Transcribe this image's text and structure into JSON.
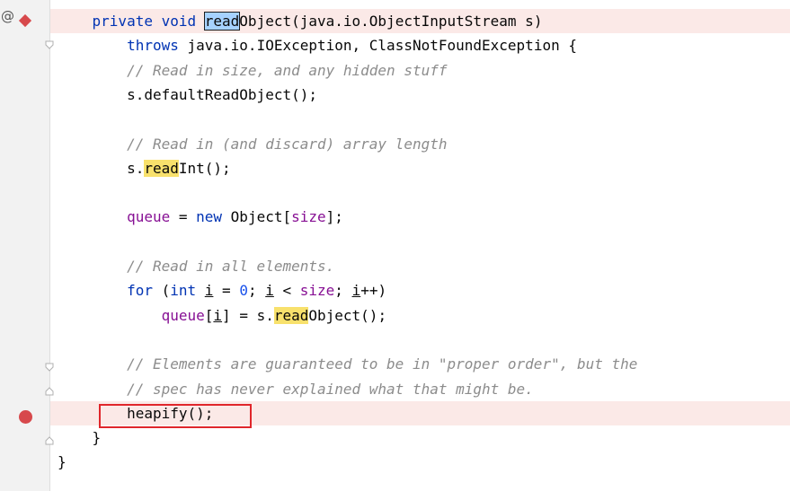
{
  "editor": {
    "lines": [
      {
        "parts": [
          {
            "t": "    "
          },
          {
            "t": "private void ",
            "c": "kw"
          },
          {
            "t": "read",
            "c": "sel"
          },
          {
            "t": "Object"
          },
          {
            "t": "(java.io.ObjectInputStream s)"
          }
        ],
        "hl": true
      },
      {
        "parts": [
          {
            "t": "        "
          },
          {
            "t": "throws ",
            "c": "kw"
          },
          {
            "t": "java.io.IOException, ClassNotFoundException {"
          }
        ]
      },
      {
        "parts": [
          {
            "t": "        "
          },
          {
            "t": "// Read in size, and any hidden stuff",
            "c": "cm"
          }
        ]
      },
      {
        "parts": [
          {
            "t": "        s.defaultReadObject();"
          }
        ]
      },
      {
        "parts": [
          {
            "t": ""
          }
        ]
      },
      {
        "parts": [
          {
            "t": "        "
          },
          {
            "t": "// Read in (and discard) array length",
            "c": "cm"
          }
        ]
      },
      {
        "parts": [
          {
            "t": "        s."
          },
          {
            "t": "read",
            "c": "hit"
          },
          {
            "t": "Int();"
          }
        ]
      },
      {
        "parts": [
          {
            "t": ""
          }
        ]
      },
      {
        "parts": [
          {
            "t": "        "
          },
          {
            "t": "queue",
            "c": "fld"
          },
          {
            "t": " = "
          },
          {
            "t": "new ",
            "c": "kw"
          },
          {
            "t": "Object["
          },
          {
            "t": "size",
            "c": "fld"
          },
          {
            "t": "];"
          }
        ]
      },
      {
        "parts": [
          {
            "t": ""
          }
        ]
      },
      {
        "parts": [
          {
            "t": "        "
          },
          {
            "t": "// Read in all elements.",
            "c": "cm"
          }
        ]
      },
      {
        "parts": [
          {
            "t": "        "
          },
          {
            "t": "for ",
            "c": "kw"
          },
          {
            "t": "("
          },
          {
            "t": "int ",
            "c": "kw"
          },
          {
            "t": "i",
            "c": "uline"
          },
          {
            "t": " = "
          },
          {
            "t": "0",
            "c": "num"
          },
          {
            "t": "; "
          },
          {
            "t": "i",
            "c": "uline"
          },
          {
            "t": " < "
          },
          {
            "t": "size",
            "c": "fld"
          },
          {
            "t": "; "
          },
          {
            "t": "i",
            "c": "uline"
          },
          {
            "t": "++)"
          }
        ]
      },
      {
        "parts": [
          {
            "t": "            "
          },
          {
            "t": "queue",
            "c": "fld"
          },
          {
            "t": "["
          },
          {
            "t": "i",
            "c": "uline"
          },
          {
            "t": "] = s."
          },
          {
            "t": "read",
            "c": "hit"
          },
          {
            "t": "Object();"
          }
        ]
      },
      {
        "parts": [
          {
            "t": ""
          }
        ]
      },
      {
        "parts": [
          {
            "t": "        "
          },
          {
            "t": "// Elements are guaranteed to be in \"proper order\", but the",
            "c": "cm"
          }
        ]
      },
      {
        "parts": [
          {
            "t": "        "
          },
          {
            "t": "// spec has never explained what that might be.",
            "c": "cm"
          }
        ]
      },
      {
        "parts": [
          {
            "t": "        heapify();"
          }
        ],
        "hl": true
      },
      {
        "parts": [
          {
            "t": "    }"
          }
        ]
      },
      {
        "parts": [
          {
            "t": "}"
          }
        ]
      }
    ]
  },
  "gutter": {
    "override_marker": "@",
    "breakpoint_line": 17
  }
}
